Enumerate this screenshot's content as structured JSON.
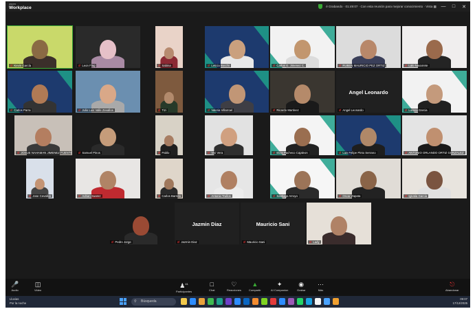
{
  "app": {
    "brand_small": "zoom",
    "brand": "Workplace"
  },
  "titlebar": {
    "status_text": "é Grabando · 01:49:07 · Con esta reunión para mejorar conocimiento · Vista ▦",
    "minimize": "—",
    "maximize": "□",
    "close": "✕"
  },
  "participants": [
    {
      "name": "Kevin García"
    },
    {
      "name": "Leon Flag"
    },
    {
      "name": "Sabina"
    },
    {
      "name": "Leticia Bocchi"
    },
    {
      "name": "Carlos G. Jimenez C."
    },
    {
      "name": "RUBEN MAURICIO PEZ ORTIZ"
    },
    {
      "name": "Lalo Navarrete"
    },
    {
      "name": "Carlos Parra"
    },
    {
      "name": "Julio Luis Valle Zevallos"
    },
    {
      "name": "Tizi"
    },
    {
      "name": "Valeria Villarroel"
    },
    {
      "name": "Ricardo Martinez"
    },
    {
      "name": "Angel Leonardo",
      "big_label": "Angel Leonardo"
    },
    {
      "name": "Lorena Garcia"
    },
    {
      "name": "JOSUE NAHAMAN JIMENEZ FUENTES"
    },
    {
      "name": "Samuel Pinos"
    },
    {
      "name": "Pablo"
    },
    {
      "name": "Vivi Vera"
    },
    {
      "name": "Eliza Pacheco Cajaleon"
    },
    {
      "name": "Luis Felipe Pinto Serrano"
    },
    {
      "name": "ANTONIO ORLANDO ORTIZ GONZALEZ"
    },
    {
      "name": "Jose Cevallos"
    },
    {
      "name": "Adrian Suarez"
    },
    {
      "name": "Carlos Barreto"
    },
    {
      "name": "Antonio Trullos"
    },
    {
      "name": "Santiago Arroyo"
    },
    {
      "name": "Oscar Zapata"
    },
    {
      "name": "Ignatia Garcia"
    },
    {
      "name": "Pedro Jorge"
    },
    {
      "name": "Jazmin Diaz",
      "big_label": "Jazmin Diaz"
    },
    {
      "name": "Mauricio Sani",
      "big_label": "Mauricio Sani"
    },
    {
      "name": "Lady"
    }
  ],
  "toolbar": {
    "audio": "Audio",
    "video": "Video",
    "participants": "Participantes",
    "participants_count": "41",
    "chat": "Chat",
    "reactions": "Reacciones",
    "share": "Compartir",
    "ai": "AI Companion",
    "record": "Grabar",
    "more": "Más",
    "leave": "Abandonar"
  },
  "taskbar": {
    "weather_line1": "Lluvias",
    "weather_line2": "Por la noche",
    "search_placeholder": "Búsqueda",
    "time": "09:07",
    "date": "17/12/2025"
  },
  "colors": {
    "accent_green": "#3aaa35",
    "muted_red": "#e33333",
    "teal_corner": "#1fa08a"
  }
}
